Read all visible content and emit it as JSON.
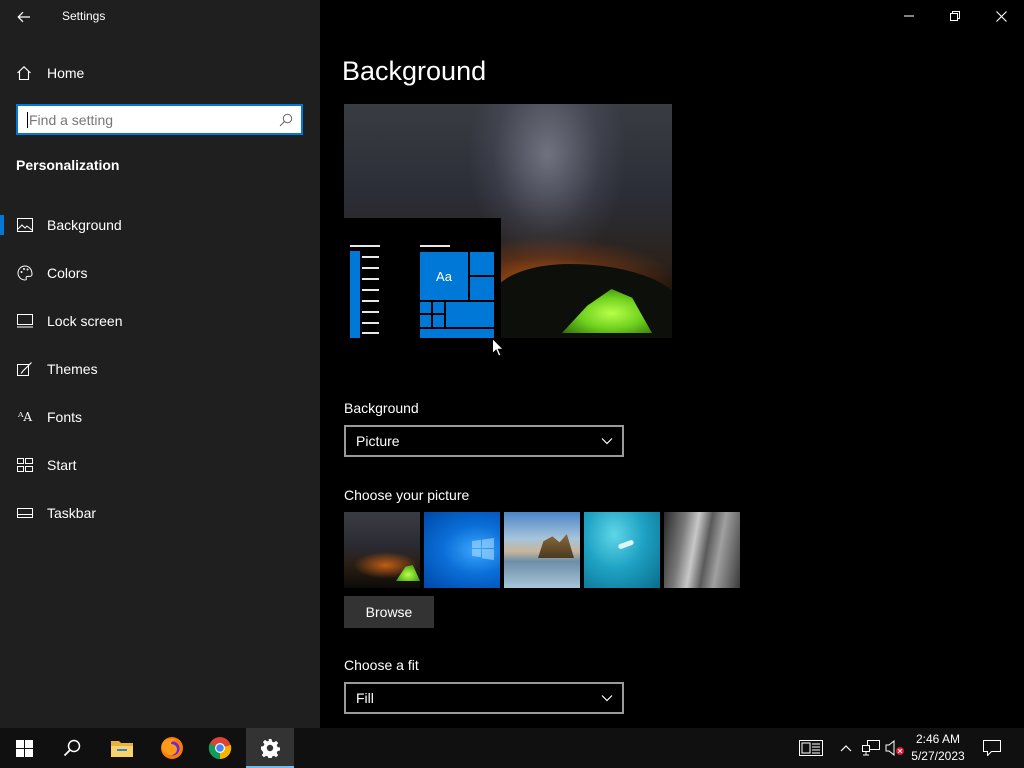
{
  "window": {
    "title": "Settings"
  },
  "sidebar": {
    "home_label": "Home",
    "search_placeholder": "Find a setting",
    "section_title": "Personalization",
    "items": [
      {
        "label": "Background",
        "icon": "picture-icon",
        "selected": true
      },
      {
        "label": "Colors",
        "icon": "palette-icon"
      },
      {
        "label": "Lock screen",
        "icon": "lock-screen-icon"
      },
      {
        "label": "Themes",
        "icon": "themes-brush-icon"
      },
      {
        "label": "Fonts",
        "icon": "fonts-icon"
      },
      {
        "label": "Start",
        "icon": "start-layout-icon"
      },
      {
        "label": "Taskbar",
        "icon": "taskbar-icon"
      }
    ]
  },
  "main": {
    "page_title": "Background",
    "preview": {
      "tile_text": "Aa"
    },
    "background_label": "Background",
    "background_value": "Picture",
    "choose_picture_label": "Choose your picture",
    "pictures": [
      "milky-way-tent",
      "windows-blue",
      "beach-rocks",
      "underwater-swimmer",
      "rock-cliff"
    ],
    "browse_label": "Browse",
    "fit_label": "Choose a fit",
    "fit_value": "Fill"
  },
  "taskbar": {
    "time": "2:46 AM",
    "date": "5/27/2023",
    "apps": [
      "windows-start-icon",
      "search-icon",
      "file-explorer-icon",
      "firefox-icon",
      "chrome-icon",
      "settings-icon"
    ]
  },
  "colors": {
    "accent": "#0078d7",
    "sidebar_bg": "#1f1f1f",
    "main_bg": "#000000",
    "taskbar_bg": "#101010"
  }
}
